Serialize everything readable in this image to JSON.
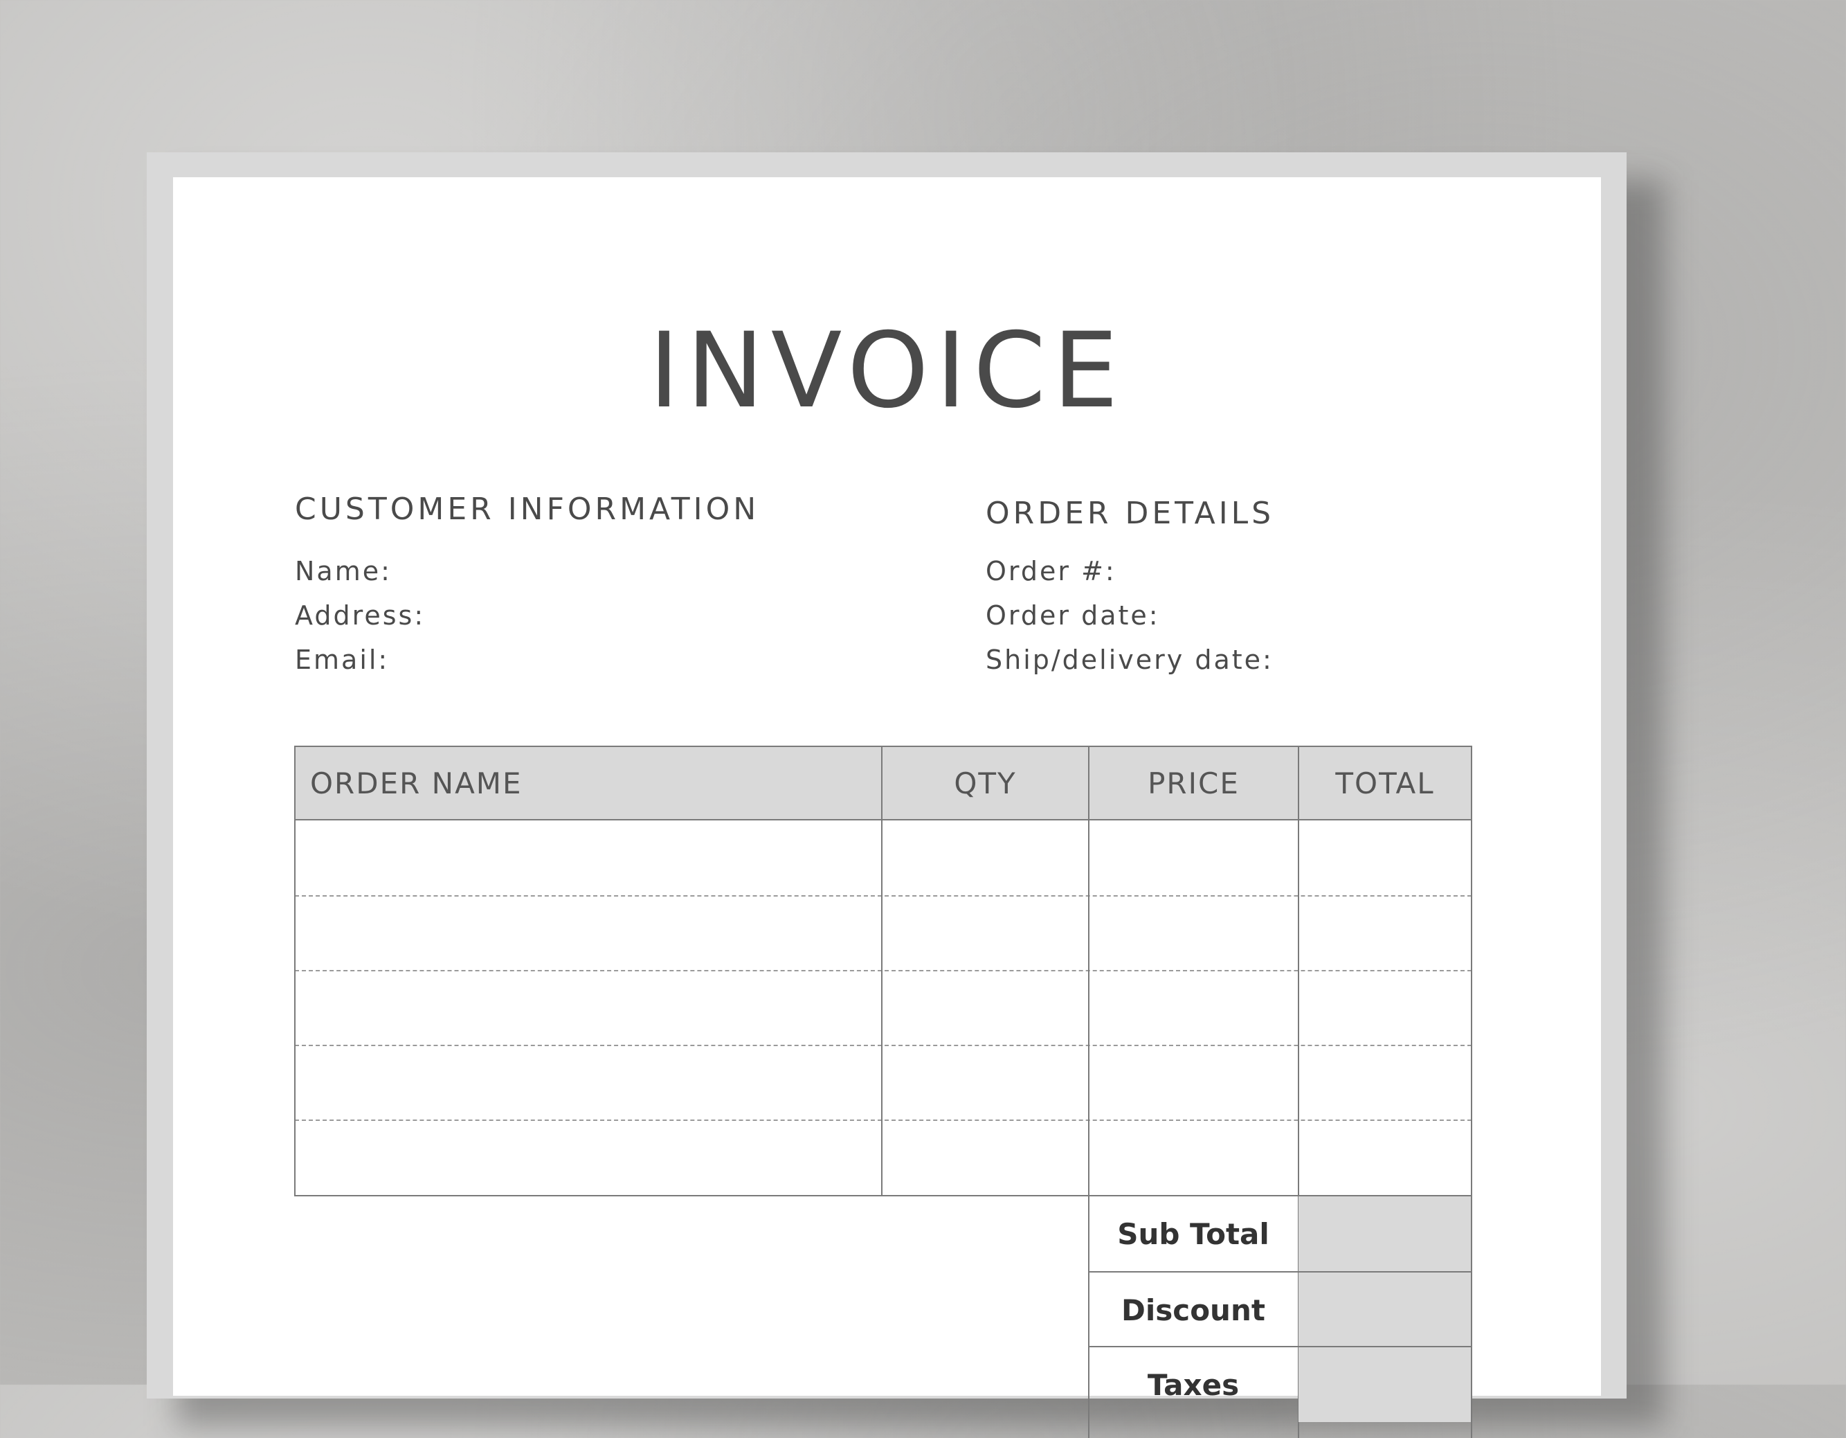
{
  "invoice": {
    "title": "INVOICE",
    "customer": {
      "heading": "CUSTOMER INFORMATION",
      "fields": [
        "Name:",
        "Address:",
        "Email:"
      ]
    },
    "order": {
      "heading": "ORDER DETAILS",
      "fields": [
        "Order #:",
        "Order date:",
        "Ship/delivery date:"
      ]
    },
    "table": {
      "headers": [
        "ORDER NAME",
        "QTY",
        "PRICE",
        "TOTAL"
      ],
      "row_count": 5
    },
    "summary": [
      "Sub Total",
      "Discount",
      "Taxes"
    ]
  }
}
